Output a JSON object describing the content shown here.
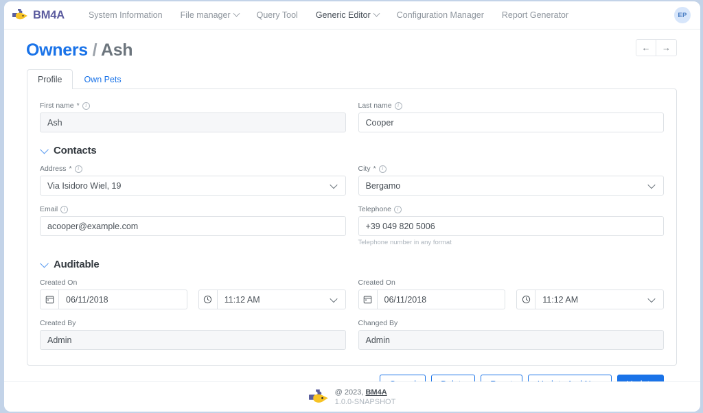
{
  "navbar": {
    "brand": "BM4A",
    "brand_logo_icon": "puzzle-bird-logo",
    "links": [
      {
        "label": "System Information",
        "has_caret": false,
        "strong": false
      },
      {
        "label": "File manager",
        "has_caret": true,
        "strong": false
      },
      {
        "label": "Query Tool",
        "has_caret": false,
        "strong": false
      },
      {
        "label": "Generic Editor",
        "has_caret": true,
        "strong": true
      },
      {
        "label": "Configuration Manager",
        "has_caret": false,
        "strong": false
      },
      {
        "label": "Report Generator",
        "has_caret": false,
        "strong": false
      }
    ],
    "avatar_initials": "EP"
  },
  "header": {
    "title_entity": "Owners",
    "title_separator": "/",
    "title_record": "Ash",
    "prev_arrow": "←",
    "next_arrow": "→"
  },
  "tabs": [
    {
      "label": "Profile",
      "active": true
    },
    {
      "label": "Own Pets",
      "active": false
    }
  ],
  "form": {
    "first_name": {
      "label": "First name",
      "required": "*",
      "value": "Ash",
      "readonly": true
    },
    "last_name": {
      "label": "Last name",
      "required": "",
      "value": "Cooper",
      "readonly": false
    },
    "contacts_section": {
      "title": "Contacts",
      "expanded": true
    },
    "address": {
      "label": "Address",
      "required": "*",
      "value": "Via Isidoro Wiel, 19"
    },
    "city": {
      "label": "City",
      "required": "*",
      "value": "Bergamo"
    },
    "email": {
      "label": "Email",
      "required": "",
      "value": "acooper@example.com"
    },
    "telephone": {
      "label": "Telephone",
      "required": "",
      "value": "+39 049 820 5006",
      "help": "Telephone number in any format"
    },
    "auditable_section": {
      "title": "Auditable",
      "expanded": true
    },
    "created_on_left": {
      "label": "Created On",
      "date": "06/11/2018",
      "time": "11:12 AM"
    },
    "created_on_right": {
      "label": "Created On",
      "date": "06/11/2018",
      "time": "11:12 AM"
    },
    "created_by": {
      "label": "Created By",
      "value": "Admin"
    },
    "changed_by": {
      "label": "Changed By",
      "value": "Admin"
    }
  },
  "buttons": {
    "cancel": "Cancel",
    "delete": "Delete",
    "reset": "Reset",
    "update_and_new": "Update And New",
    "update": "Update"
  },
  "footer": {
    "copyright_prefix": "@ 2023,",
    "copyright_brand": "BM4A",
    "version": "1.0.0-SNAPSHOT",
    "logo_icon": "puzzle-bird-logo"
  },
  "colors": {
    "accent": "#1a73e8",
    "brand_purple": "#5a5a9e",
    "brand_yellow": "#f5c518",
    "muted": "#6c757d",
    "border": "#dee2e6",
    "readonly_bg": "#f6f7f9"
  }
}
